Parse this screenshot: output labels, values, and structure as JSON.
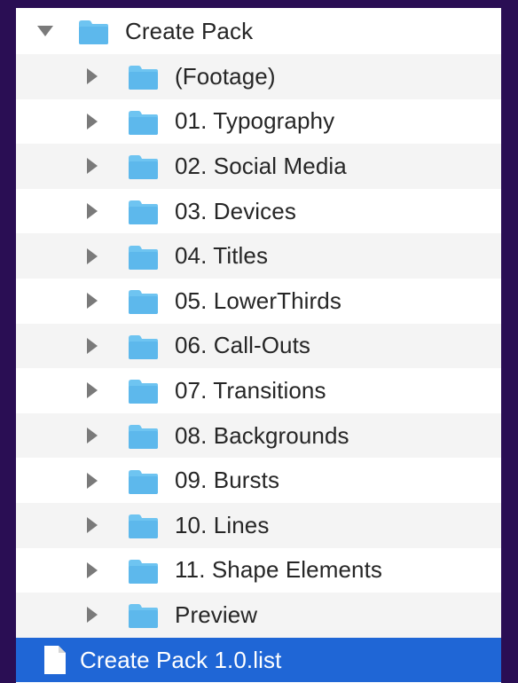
{
  "tree": {
    "root": {
      "label": "Create Pack",
      "icon": "folder-icon",
      "expanded": true
    },
    "children": [
      {
        "label": "(Footage)",
        "icon": "folder-icon"
      },
      {
        "label": "01. Typography",
        "icon": "folder-icon"
      },
      {
        "label": "02. Social Media",
        "icon": "folder-icon"
      },
      {
        "label": "03. Devices",
        "icon": "folder-icon"
      },
      {
        "label": "04. Titles",
        "icon": "folder-icon"
      },
      {
        "label": "05. LowerThirds",
        "icon": "folder-icon"
      },
      {
        "label": "06. Call-Outs",
        "icon": "folder-icon"
      },
      {
        "label": "07. Transitions",
        "icon": "folder-icon"
      },
      {
        "label": "08. Backgrounds",
        "icon": "folder-icon"
      },
      {
        "label": "09. Bursts",
        "icon": "folder-icon"
      },
      {
        "label": "10. Lines",
        "icon": "folder-icon"
      },
      {
        "label": "11. Shape Elements",
        "icon": "folder-icon"
      },
      {
        "label": "Preview",
        "icon": "folder-icon"
      }
    ],
    "selected_file": {
      "label": "Create Pack 1.0.list",
      "icon": "document-icon"
    }
  },
  "colors": {
    "background": "#2a0e54",
    "panel": "#ffffff",
    "stripe": "#f4f4f4",
    "selection": "#1f66d6",
    "folder": "#60bdef",
    "disclosure": "#7a7a7a",
    "text": "#262626"
  }
}
